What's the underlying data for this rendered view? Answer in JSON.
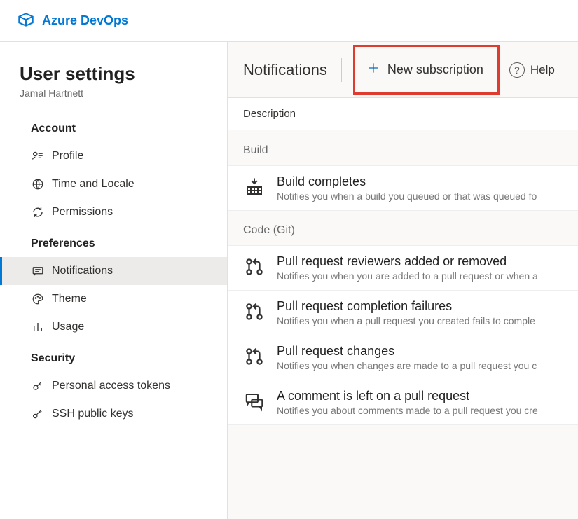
{
  "brand": "Azure DevOps",
  "page_title": "User settings",
  "user_name": "Jamal Hartnett",
  "sidebar": {
    "sections": [
      {
        "label": "Account",
        "items": [
          {
            "id": "profile",
            "label": "Profile",
            "active": false
          },
          {
            "id": "time-locale",
            "label": "Time and Locale",
            "active": false
          },
          {
            "id": "permissions",
            "label": "Permissions",
            "active": false
          }
        ]
      },
      {
        "label": "Preferences",
        "items": [
          {
            "id": "notifications",
            "label": "Notifications",
            "active": true
          },
          {
            "id": "theme",
            "label": "Theme",
            "active": false
          },
          {
            "id": "usage",
            "label": "Usage",
            "active": false
          }
        ]
      },
      {
        "label": "Security",
        "items": [
          {
            "id": "pat",
            "label": "Personal access tokens",
            "active": false
          },
          {
            "id": "ssh",
            "label": "SSH public keys",
            "active": false
          }
        ]
      }
    ]
  },
  "toolbar": {
    "title": "Notifications",
    "new_subscription": "New subscription",
    "help": "Help"
  },
  "description_header": "Description",
  "groups": [
    {
      "label": "Build",
      "items": [
        {
          "icon": "build",
          "title": "Build completes",
          "desc": "Notifies you when a build you queued or that was queued fo"
        }
      ]
    },
    {
      "label": "Code (Git)",
      "items": [
        {
          "icon": "pr",
          "title": "Pull request reviewers added or removed",
          "desc": "Notifies you when you are added to a pull request or when a"
        },
        {
          "icon": "pr",
          "title": "Pull request completion failures",
          "desc": "Notifies you when a pull request you created fails to comple"
        },
        {
          "icon": "pr",
          "title": "Pull request changes",
          "desc": "Notifies you when changes are made to a pull request you c"
        },
        {
          "icon": "comment",
          "title": "A comment is left on a pull request",
          "desc": "Notifies you about comments made to a pull request you cre"
        }
      ]
    }
  ]
}
